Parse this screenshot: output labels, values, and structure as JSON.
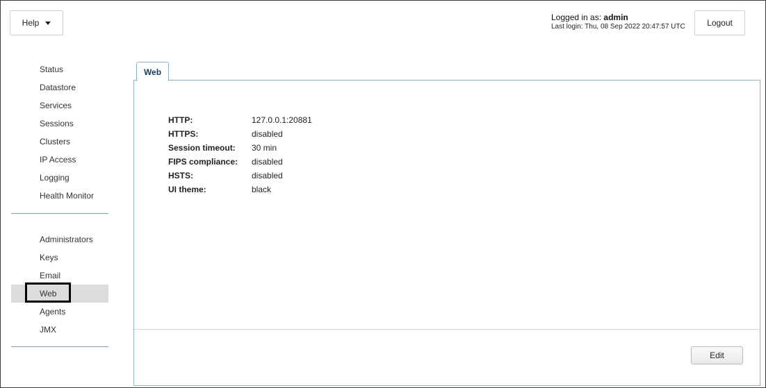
{
  "header": {
    "help_label": "Help",
    "logged_in_prefix": "Logged in as: ",
    "username": "admin",
    "last_login": "Last login: Thu, 08 Sep 2022 20:47:57 UTC",
    "logout_label": "Logout"
  },
  "sidebar": {
    "group1": [
      "Status",
      "Datastore",
      "Services",
      "Sessions",
      "Clusters",
      "IP Access",
      "Logging",
      "Health Monitor"
    ],
    "group2": [
      "Administrators",
      "Keys",
      "Email",
      "Web",
      "Agents",
      "JMX"
    ],
    "active": "Web"
  },
  "tab": {
    "label": "Web"
  },
  "settings": {
    "http": {
      "label": "HTTP:",
      "value": "127.0.0.1:20881"
    },
    "https": {
      "label": "HTTPS:",
      "value": "disabled"
    },
    "session_timeout": {
      "label": "Session timeout:",
      "value": "30 min"
    },
    "fips": {
      "label": "FIPS compliance:",
      "value": "disabled"
    },
    "hsts": {
      "label": "HSTS:",
      "value": "disabled"
    },
    "ui_theme": {
      "label": "UI theme:",
      "value": "black"
    }
  },
  "actions": {
    "edit_label": "Edit"
  },
  "colors": {
    "panel_border": "#8db3cc",
    "tab_text": "#1d3a55",
    "active_bg": "#dcdcdc"
  }
}
